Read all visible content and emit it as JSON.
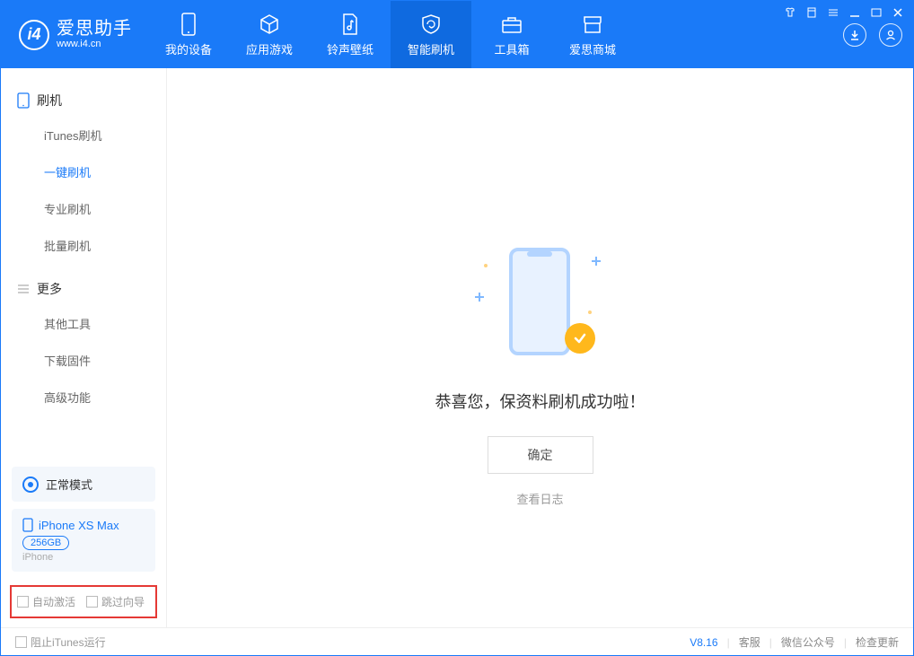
{
  "app": {
    "title": "爱思助手",
    "url": "www.i4.cn"
  },
  "header_tabs": [
    {
      "label": "我的设备"
    },
    {
      "label": "应用游戏"
    },
    {
      "label": "铃声壁纸"
    },
    {
      "label": "智能刷机"
    },
    {
      "label": "工具箱"
    },
    {
      "label": "爱思商城"
    }
  ],
  "sidebar": {
    "group1_title": "刷机",
    "items1": [
      {
        "label": "iTunes刷机"
      },
      {
        "label": "一键刷机"
      },
      {
        "label": "专业刷机"
      },
      {
        "label": "批量刷机"
      }
    ],
    "group2_title": "更多",
    "items2": [
      {
        "label": "其他工具"
      },
      {
        "label": "下载固件"
      },
      {
        "label": "高级功能"
      }
    ]
  },
  "device": {
    "mode_label": "正常模式",
    "name": "iPhone XS Max",
    "capacity": "256GB",
    "subtype": "iPhone"
  },
  "side_checks": {
    "auto_activate": "自动激活",
    "skip_guide": "跳过向导"
  },
  "main": {
    "success_text": "恭喜您，保资料刷机成功啦！",
    "ok_label": "确定",
    "log_link": "查看日志"
  },
  "footer": {
    "block_itunes": "阻止iTunes运行",
    "version": "V8.16",
    "cs": "客服",
    "wechat": "微信公众号",
    "update": "检查更新"
  }
}
